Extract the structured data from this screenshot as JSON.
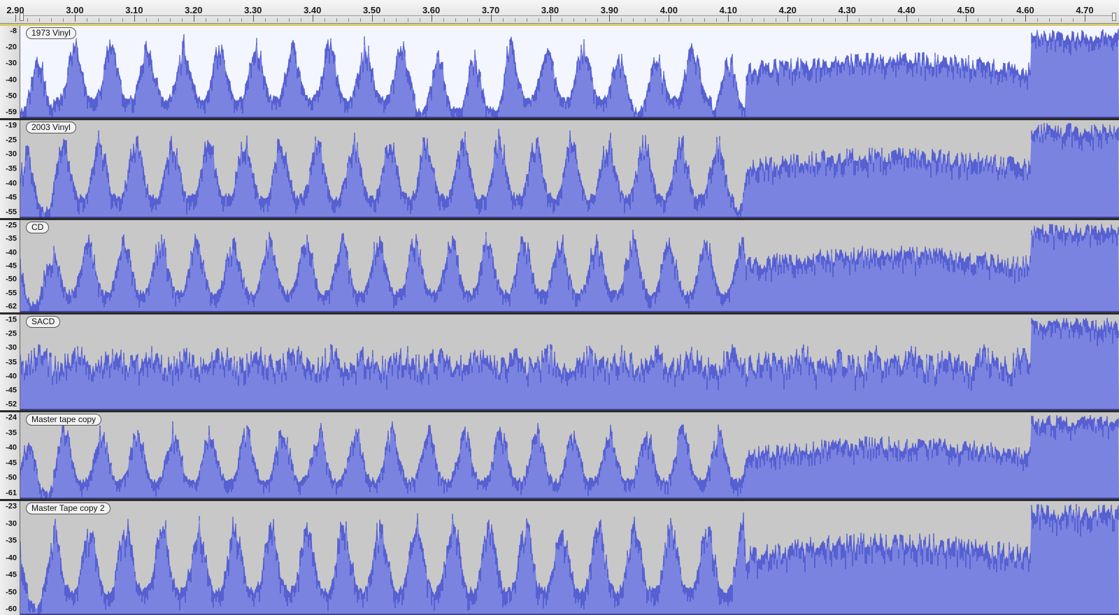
{
  "timeline": {
    "labels": [
      "2.90",
      "3.00",
      "3.10",
      "3.20",
      "3.30",
      "3.40",
      "3.50",
      "3.60",
      "3.70",
      "3.80",
      "3.90",
      "4.00",
      "4.10",
      "4.20",
      "4.30",
      "4.40",
      "4.50",
      "4.60",
      "4.70"
    ]
  },
  "colors": {
    "wave_fill": "#7a83df",
    "wave_peak": "#3f49c8",
    "selected_bg": "#f3f6ff",
    "track_bg": "#c8c8c8",
    "selected_border": "#d8c96a"
  },
  "tracks": [
    {
      "name": "1973 Vinyl",
      "selected": true,
      "scale": [
        "-8",
        "-20",
        "-30",
        "-40",
        "-50",
        "-59"
      ],
      "loud_regions": [
        [
          0.03,
          0.36
        ],
        [
          0.44,
          0.48
        ],
        [
          0.48,
          0.54
        ],
        [
          0.585,
          0.63
        ],
        [
          0.69,
          0.72
        ]
      ],
      "quiet_level": 0.12
    },
    {
      "name": "2003 Vinyl",
      "selected": false,
      "scale": [
        "-19",
        "-25",
        "-30",
        "-35",
        "-40",
        "-45",
        "-55"
      ],
      "loud_regions": [
        [
          0.03,
          0.65
        ],
        [
          0.69,
          0.77
        ],
        [
          0.79,
          0.83
        ]
      ],
      "quiet_level": 0.2
    },
    {
      "name": "CD",
      "selected": false,
      "scale": [
        "-25",
        "-35",
        "-40",
        "-45",
        "-50",
        "-55",
        "-62"
      ],
      "loud_regions": [
        [
          0.03,
          0.86
        ],
        [
          0.87,
          0.98
        ]
      ],
      "quiet_level": 0.25
    },
    {
      "name": "SACD",
      "selected": false,
      "scale": [
        "-15",
        "-25",
        "-30",
        "-35",
        "-40",
        "-45",
        "-52"
      ],
      "loud_regions": [
        [
          0.03,
          0.92
        ]
      ],
      "quiet_level": 0.4
    },
    {
      "name": "Master tape copy",
      "selected": false,
      "scale": [
        "-24",
        "-35",
        "-40",
        "-45",
        "-50",
        "-61"
      ],
      "loud_regions": [
        [
          0.03,
          0.93
        ]
      ],
      "quiet_level": 0.3
    },
    {
      "name": "Master Tape copy 2",
      "selected": false,
      "scale": [
        "-23",
        "-30",
        "-35",
        "-40",
        "-45",
        "-50",
        "-60"
      ],
      "loud_regions": [
        [
          0.03,
          0.92
        ]
      ],
      "quiet_level": 0.28
    }
  ]
}
